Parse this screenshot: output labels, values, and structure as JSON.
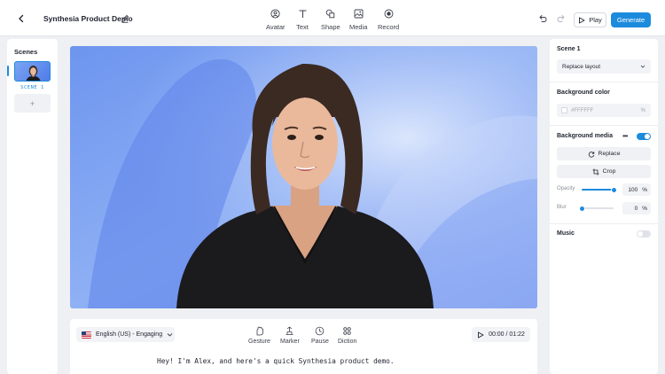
{
  "app": {
    "title": "Synthesia Product Demo"
  },
  "toolbar": {
    "tools": [
      {
        "label": "Avatar",
        "icon": "avatar-icon"
      },
      {
        "label": "Text",
        "icon": "text-icon"
      },
      {
        "label": "Shape",
        "icon": "shape-icon"
      },
      {
        "label": "Media",
        "icon": "media-icon"
      },
      {
        "label": "Record",
        "icon": "record-icon"
      }
    ],
    "play_label": "Play",
    "generate_label": "Generate"
  },
  "scenes": {
    "title": "Scenes",
    "items": [
      {
        "label": "SCENE 1",
        "selected": true
      }
    ],
    "add_label": "+"
  },
  "script": {
    "language": "English (US) - Engaging",
    "tools": [
      {
        "label": "Gesture",
        "icon": "gesture-icon"
      },
      {
        "label": "Marker",
        "icon": "marker-icon"
      },
      {
        "label": "Pause",
        "icon": "pause-icon"
      },
      {
        "label": "Diction",
        "icon": "diction-icon"
      }
    ],
    "timer": "00:00 / 01:22",
    "text": "Hey! I'm Alex, and here's a quick Synthesia product demo."
  },
  "properties": {
    "scene_title": "Scene 1",
    "layout_select": "Replace layout",
    "bg_color_title": "Background color",
    "bg_color_value": "#FFFFFF",
    "bg_color_unit": "%",
    "bg_media_title": "Background media",
    "bg_media_enabled": true,
    "replace_label": "Replace",
    "crop_label": "Crop",
    "opacity_label": "Opacity",
    "opacity_value": "100",
    "opacity_unit": "%",
    "opacity_level": 1.0,
    "blur_label": "Blur",
    "blur_value": "0",
    "blur_unit": "%",
    "blur_level": 0.0,
    "music_title": "Music",
    "music_enabled": false
  },
  "colors": {
    "accent": "#1d8bdd",
    "canvas_bg": "#5b86ec",
    "avatar_top": "#1b1b1e"
  }
}
